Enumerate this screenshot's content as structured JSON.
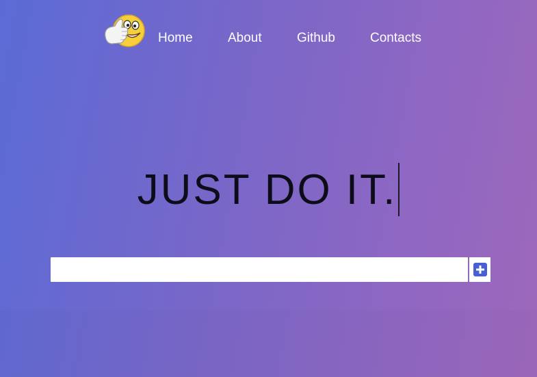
{
  "nav": {
    "logo_icon": "thumbs-up-smiley-icon",
    "items": [
      {
        "label": "Home"
      },
      {
        "label": "About"
      },
      {
        "label": "Github"
      },
      {
        "label": "Contacts"
      }
    ]
  },
  "hero": {
    "headline": "JUST DO IT."
  },
  "todo": {
    "input_value": "",
    "add_icon": "plus-square-icon"
  },
  "colors": {
    "gradient_start": "#5b6bd6",
    "gradient_end": "#9d68bb",
    "add_icon": "#4a5fd2",
    "headline": "#0d0d1a"
  }
}
